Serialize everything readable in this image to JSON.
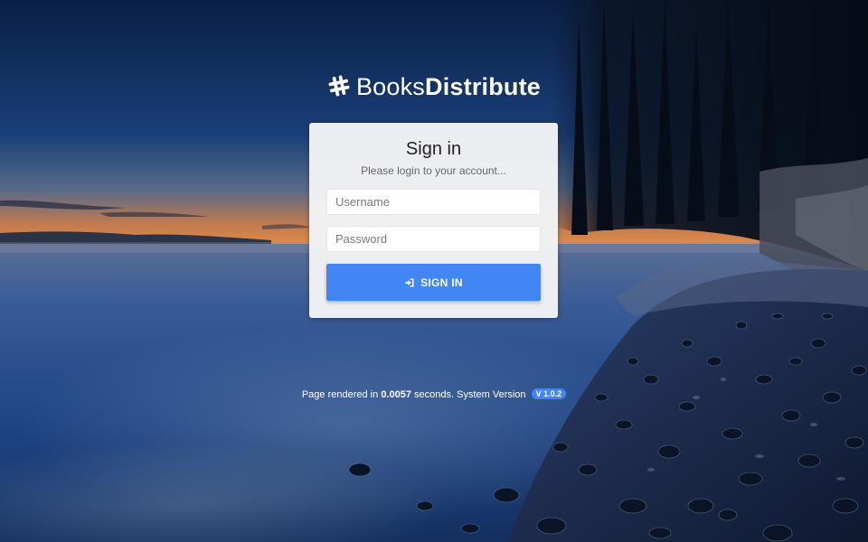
{
  "brand": {
    "icon": "hashtag-icon",
    "light": "Books",
    "bold": "Distribute"
  },
  "login": {
    "title": "Sign in",
    "subtitle": "Please login to your account...",
    "username_placeholder": "Username",
    "username_value": "",
    "password_placeholder": "Password",
    "password_value": "",
    "button_icon": "sign-in-icon",
    "button_label": "SIGN IN"
  },
  "footer": {
    "prefix": "Page rendered in",
    "render_time": "0.0057",
    "middle": "seconds. System Version",
    "version": "V 1.0.2"
  },
  "colors": {
    "accent": "#4285f4",
    "card": "#f3f3f5",
    "sky": "#0f2a55"
  }
}
